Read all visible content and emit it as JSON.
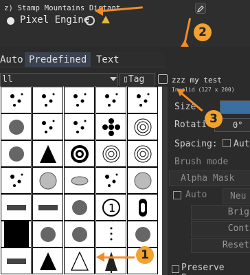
{
  "header": {
    "brush_title": "z) Stamp Mountains Distant",
    "engine_name": "Pixel Engine",
    "edit_icon": "pencil-icon",
    "reload_icon": "reload-icon",
    "warning_icon": "warning-icon",
    "warning_color": "#e2b93b"
  },
  "tabs": [
    {
      "label": "Auto"
    },
    {
      "label": "Predefined"
    },
    {
      "label": "Text"
    }
  ],
  "filter": {
    "selected": "ll",
    "tag_label": "Tag",
    "tag_icon": "tag-icon",
    "edit_icon": "edit-tags-icon"
  },
  "preset": {
    "name": "zzz my test",
    "status": "Invalid (127 x 200)"
  },
  "properties": {
    "size_label": "Size",
    "rotation_label": "Rotati",
    "rotation_value": "0°",
    "spacing_label": "Spacing:",
    "spacing_auto": "Auto",
    "brush_mode_label": "Brush mode",
    "alpha_mask_label": "Alpha Mask",
    "auto_label": "Auto",
    "neu_label": "Neu",
    "bright_label": "Brig",
    "contrast_label": "Cont",
    "reset_label": "Reset",
    "preserve_label": "Preserve Brus"
  },
  "callouts": [
    {
      "number": "1"
    },
    {
      "number": "2"
    },
    {
      "number": "3"
    }
  ],
  "grid": {
    "shapes": [
      "dots-texture",
      "wavy-lines",
      "ink-splatter",
      "dots-cluster",
      "noise-texture",
      "splat-blob",
      "stipple-circle",
      "square-dots",
      "cross-dots",
      "target-circle",
      "splatter-dark",
      "triangle-black",
      "concentric-rings",
      "concentric-circles",
      "radial-circles",
      "dots-arc",
      "gray-circle",
      "gray-ellipse",
      "gray-dots",
      "gray-circle-large",
      "stroke-dab",
      "hatch-dab",
      "smoke-puff",
      "number-one",
      "keyhole",
      "black-square",
      "blur-gradient",
      "soft-blob",
      "dots-vertical",
      "fluffy-blob",
      "stripe-fade",
      "triangle-filled",
      "triangle-outline",
      "pine-tree",
      "empty"
    ]
  },
  "accent_colors": {
    "callout": "#f2a22f",
    "active_tab": "#3b4350",
    "size_field": "#3b6fa0"
  }
}
